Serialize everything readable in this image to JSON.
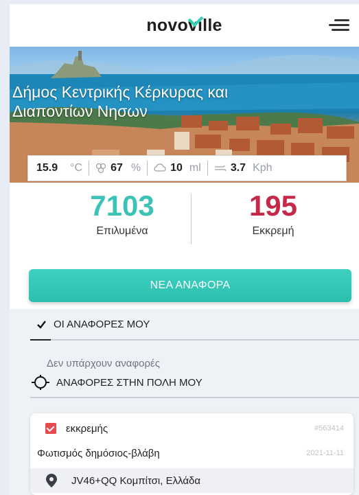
{
  "header": {
    "logo_part1": "novo",
    "logo_part2": "ville",
    "menu_icon": "hamburger-menu-icon"
  },
  "hero": {
    "title_line1": "Δήμος Κεντρικής Κέρκυρας και",
    "title_line2": "Διαποντίων Νησων"
  },
  "weather": {
    "temperature": "15.9",
    "temperature_unit": "°C",
    "humidity": "67",
    "humidity_unit": "%",
    "rain": "10",
    "rain_unit": "ml",
    "wind": "3.7",
    "wind_unit": "Kph"
  },
  "stats": {
    "resolved_count": "7103",
    "resolved_label": "Επιλυμένα",
    "pending_count": "195",
    "pending_label": "Εκκρεμή"
  },
  "new_report_button": "ΝΕΑ ΑΝΑΦΟΡΑ",
  "tabs": {
    "my_reports": "ΟΙ ΑΝΑΦΟΡΕΣ ΜΟΥ",
    "no_reports": "Δεν υπάρχουν αναφορές",
    "city_reports": "ΑΝΑΦΟΡΕΣ ΣΤΗΝ ΠΟΛΗ ΜΟΥ"
  },
  "report_card": {
    "status": "εκκρεμής",
    "id": "#563414",
    "category": "Φωτισμός δημόσιος-βλάβη",
    "date": "2021-11-11",
    "location": "JV46+QQ Κομπίτσι, Ελλάδα"
  },
  "colors": {
    "accent": "#2ec4b6",
    "resolved": "#3cc3b5",
    "pending": "#c42949",
    "status_checkbox": "#e8494f"
  }
}
